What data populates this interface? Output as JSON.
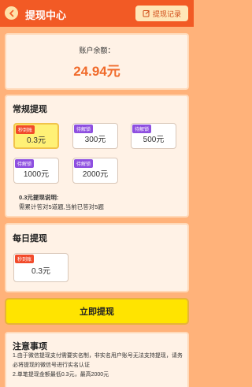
{
  "header": {
    "title": "提现中心",
    "record_label": "提现记录"
  },
  "balance": {
    "label": "账户余额：",
    "value": "24.94元"
  },
  "regular": {
    "title": "常规提现",
    "options": [
      {
        "tag": "秒到账",
        "amount": "0.3元",
        "selected": true
      },
      {
        "tag": "待解锁",
        "amount": "300元",
        "selected": false
      },
      {
        "tag": "待解锁",
        "amount": "500元",
        "selected": false
      },
      {
        "tag": "待解锁",
        "amount": "1000元",
        "selected": false
      },
      {
        "tag": "待解锁",
        "amount": "2000元",
        "selected": false
      }
    ],
    "note_title": "0.3元提现说明:",
    "note_body": "需累计答对5道题,当前已答对5题"
  },
  "daily": {
    "title": "每日提现",
    "options": [
      {
        "tag": "秒到账",
        "amount": "0.3元",
        "selected": false
      }
    ]
  },
  "withdraw_label": "立即提现",
  "notice": {
    "title": "注意事项",
    "text": "1.由于微信提现支付需要实名制，非实名用户账号无法支持提现，请务必将提现的微信号进行实名认证",
    "text2": "2.单笔提现金额最低0.3元，最高2000元"
  },
  "colors": {
    "header": "#f25a25",
    "background": "#ffb27a",
    "accent": "#f06a2a",
    "button": "#ffe400"
  }
}
